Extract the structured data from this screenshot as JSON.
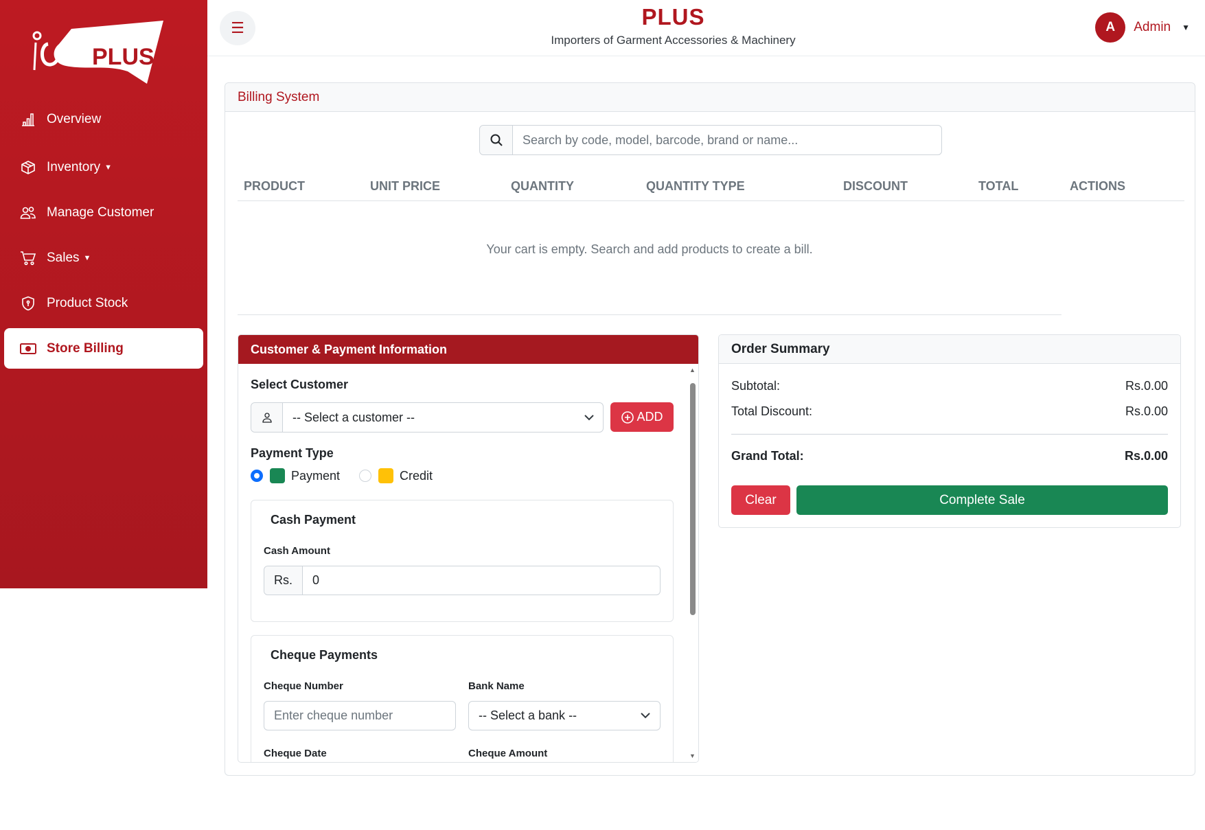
{
  "sidebar": {
    "logo_text": "PLUS",
    "items": [
      {
        "label": "Overview",
        "icon": "bar-chart-icon",
        "active": false
      },
      {
        "label": "Inventory",
        "icon": "box-icon",
        "active": false,
        "has_caret": true
      },
      {
        "label": "Manage Customer",
        "icon": "users-icon",
        "active": false
      },
      {
        "label": "Sales",
        "icon": "cart-icon",
        "active": false,
        "has_caret": true
      },
      {
        "label": "Product Stock",
        "icon": "shield-icon",
        "active": false
      },
      {
        "label": "Store Billing",
        "icon": "cash-icon",
        "active": true
      }
    ]
  },
  "header": {
    "title": "PLUS",
    "subtitle": "Importers of Garment Accessories & Machinery",
    "user_initial": "A",
    "user_name": "Admin"
  },
  "billing": {
    "title": "Billing System",
    "search": {
      "placeholder": "Search by code, model, barcode, brand or name..."
    },
    "table": {
      "columns": [
        "PRODUCT",
        "UNIT PRICE",
        "QUANTITY",
        "QUANTITY TYPE",
        "DISCOUNT",
        "TOTAL",
        "ACTIONS"
      ],
      "rows": [],
      "empty_message": "Your cart is empty. Search and add products to create a bill."
    }
  },
  "customer_payment": {
    "title": "Customer & Payment Information",
    "select_customer_label": "Select Customer",
    "customer_value": "-- Select a customer --",
    "add_label": "ADD",
    "payment_type_label": "Payment Type",
    "payment_types": [
      {
        "label": "Payment",
        "color": "#198754",
        "checked": true
      },
      {
        "label": "Credit",
        "color": "#ffc107",
        "checked": false
      }
    ],
    "cash": {
      "title": "Cash Payment",
      "amount_label": "Cash Amount",
      "prefix": "Rs.",
      "value": "0"
    },
    "cheque": {
      "title": "Cheque Payments",
      "number_label": "Cheque Number",
      "number_placeholder": "Enter cheque number",
      "bank_label": "Bank Name",
      "bank_value": "-- Select a bank --",
      "date_label": "Cheque Date",
      "amount_label": "Cheque Amount"
    }
  },
  "order_summary": {
    "title": "Order Summary",
    "subtotal_label": "Subtotal:",
    "subtotal_value": "Rs.0.00",
    "discount_label": "Total Discount:",
    "discount_value": "Rs.0.00",
    "grand_label": "Grand Total:",
    "grand_value": "Rs.0.00",
    "clear_label": "Clear",
    "complete_label": "Complete Sale"
  },
  "colors": {
    "brand_red": "#b0171f",
    "danger": "#dc3545",
    "success": "#198754",
    "warning": "#ffc107",
    "primary": "#0d6efd"
  }
}
